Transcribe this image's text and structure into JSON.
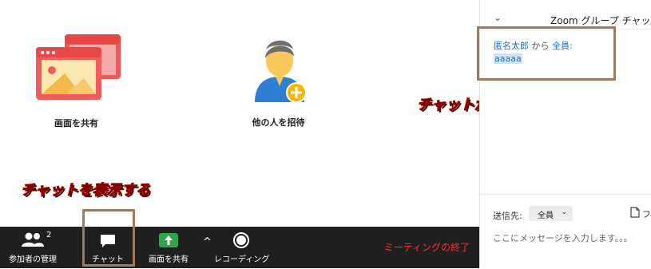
{
  "main": {
    "share_screen_label": "画面を共有",
    "invite_label": "他の人を招待"
  },
  "toolbar": {
    "participants_label": "参加者の管理",
    "participants_count": "2",
    "chat_label": "チャット",
    "share_label": "画面を共有",
    "more_icon_text": "^",
    "record_label": "レコーディング",
    "end_label": "ミーティングの終了"
  },
  "annotations": {
    "show_chat": "チャットを表示する",
    "chat_shows_here": "チャットがここに表示される"
  },
  "chat": {
    "title": "Zoom グループ チャット",
    "message": {
      "sender": "匿名太郎",
      "from_word": "から",
      "recipient": "全員:",
      "text": "aaaaa"
    },
    "send_to_label": "送信先:",
    "send_to_value": "全員",
    "file_label": "フ",
    "input_placeholder": "ここにメッセージを入力します。。。"
  },
  "colors": {
    "toolbar_bg": "#1f1f1f",
    "share_green": "#2ea449",
    "end_red": "#ff2f2f",
    "link_blue": "#1b73c9",
    "annotation_border": "#a07a5c",
    "callout_orange": "#ff7a00"
  },
  "icons": {
    "share_screen": "share-screen-icon",
    "invite": "invite-person-icon",
    "participants": "participants-icon",
    "chat": "chat-bubble-icon",
    "share": "share-arrow-icon",
    "record": "record-icon",
    "file": "file-icon",
    "chevron": "chevron-down-icon"
  }
}
